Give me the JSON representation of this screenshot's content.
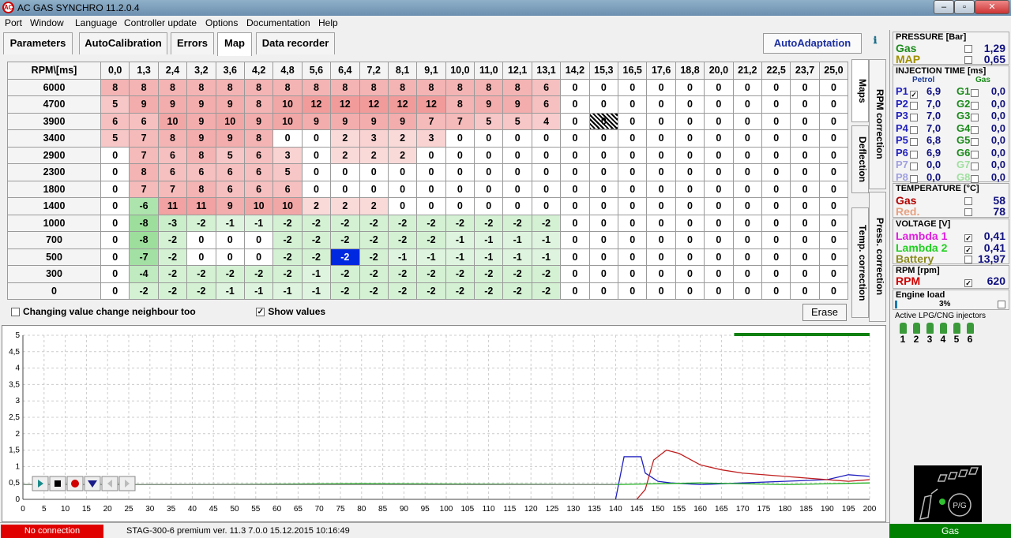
{
  "window": {
    "title": "AC GAS SYNCHRO  11.2.0.4",
    "min": "–",
    "max": "▫",
    "close": "✕"
  },
  "menu": [
    "Port",
    "Window",
    "Language",
    "Controller update",
    "Options",
    "Documentation",
    "Help"
  ],
  "tabs": [
    "Parameters",
    "AutoCalibration",
    "Errors",
    "Map",
    "Data recorder"
  ],
  "autoadaptation_label": "AutoAdaptation",
  "grid": {
    "corner": "RPM\\[ms]",
    "columns": [
      "0,0",
      "1,3",
      "2,4",
      "3,2",
      "3,6",
      "4,2",
      "4,8",
      "5,6",
      "6,4",
      "7,2",
      "8,1",
      "9,1",
      "10,0",
      "11,0",
      "12,1",
      "13,1",
      "14,2",
      "15,3",
      "16,5",
      "17,6",
      "18,8",
      "20,0",
      "21,2",
      "22,5",
      "23,7",
      "25,0"
    ],
    "rows": [
      {
        "rpm": "6000",
        "v": [
          8,
          8,
          8,
          8,
          8,
          8,
          8,
          8,
          8,
          8,
          8,
          8,
          8,
          8,
          8,
          6,
          0,
          0,
          0,
          0,
          0,
          0,
          0,
          0,
          0,
          0
        ]
      },
      {
        "rpm": "4700",
        "v": [
          5,
          9,
          9,
          9,
          9,
          8,
          10,
          12,
          12,
          12,
          12,
          12,
          8,
          9,
          9,
          6,
          0,
          0,
          0,
          0,
          0,
          0,
          0,
          0,
          0,
          0
        ]
      },
      {
        "rpm": "3900",
        "v": [
          6,
          6,
          10,
          9,
          10,
          9,
          10,
          9,
          9,
          9,
          9,
          7,
          7,
          5,
          5,
          4,
          0,
          0,
          0,
          0,
          0,
          0,
          0,
          0,
          0,
          0
        ]
      },
      {
        "rpm": "3400",
        "v": [
          5,
          7,
          8,
          9,
          9,
          8,
          0,
          0,
          2,
          3,
          2,
          3,
          0,
          0,
          0,
          0,
          0,
          0,
          0,
          0,
          0,
          0,
          0,
          0,
          0,
          0
        ]
      },
      {
        "rpm": "2900",
        "v": [
          0,
          7,
          6,
          8,
          5,
          6,
          3,
          0,
          2,
          2,
          2,
          0,
          0,
          0,
          0,
          0,
          0,
          0,
          0,
          0,
          0,
          0,
          0,
          0,
          0,
          0
        ]
      },
      {
        "rpm": "2300",
        "v": [
          0,
          8,
          6,
          6,
          6,
          6,
          5,
          0,
          0,
          0,
          0,
          0,
          0,
          0,
          0,
          0,
          0,
          0,
          0,
          0,
          0,
          0,
          0,
          0,
          0,
          0
        ]
      },
      {
        "rpm": "1800",
        "v": [
          0,
          7,
          7,
          8,
          6,
          6,
          6,
          0,
          0,
          0,
          0,
          0,
          0,
          0,
          0,
          0,
          0,
          0,
          0,
          0,
          0,
          0,
          0,
          0,
          0,
          0
        ]
      },
      {
        "rpm": "1400",
        "v": [
          0,
          -6,
          11,
          11,
          9,
          10,
          10,
          2,
          2,
          2,
          0,
          0,
          0,
          0,
          0,
          0,
          0,
          0,
          0,
          0,
          0,
          0,
          0,
          0,
          0,
          0
        ]
      },
      {
        "rpm": "1000",
        "v": [
          0,
          -8,
          -3,
          -2,
          -1,
          -1,
          -2,
          -2,
          -2,
          -2,
          -2,
          -2,
          -2,
          -2,
          -2,
          -2,
          0,
          0,
          0,
          0,
          0,
          0,
          0,
          0,
          0,
          0
        ]
      },
      {
        "rpm": "700",
        "v": [
          0,
          -8,
          -2,
          0,
          0,
          0,
          -2,
          -2,
          -2,
          -2,
          -2,
          -2,
          -1,
          -1,
          -1,
          -1,
          0,
          0,
          0,
          0,
          0,
          0,
          0,
          0,
          0,
          0
        ]
      },
      {
        "rpm": "500",
        "v": [
          0,
          -7,
          -2,
          0,
          0,
          0,
          -2,
          -2,
          -2,
          -2,
          -1,
          -1,
          -1,
          -1,
          -1,
          -1,
          0,
          0,
          0,
          0,
          0,
          0,
          0,
          0,
          0,
          0
        ]
      },
      {
        "rpm": "300",
        "v": [
          0,
          -4,
          -2,
          -2,
          -2,
          -2,
          -2,
          -1,
          -2,
          -2,
          -2,
          -2,
          -2,
          -2,
          -2,
          -2,
          0,
          0,
          0,
          0,
          0,
          0,
          0,
          0,
          0,
          0
        ]
      },
      {
        "rpm": "0",
        "v": [
          0,
          -2,
          -2,
          -2,
          -1,
          -1,
          -1,
          -1,
          -2,
          -2,
          -2,
          -2,
          -2,
          -2,
          -2,
          -2,
          0,
          0,
          0,
          0,
          0,
          0,
          0,
          0,
          0,
          0
        ]
      }
    ],
    "selected_cell": {
      "row": 10,
      "col": 8
    },
    "hatched_cell": {
      "row": 2,
      "col": 17
    }
  },
  "side_tabs": [
    "Maps",
    "RPM correction",
    "Deflection",
    "Temp. correction",
    "Press. correction"
  ],
  "options": {
    "neighbour_label": "Changing value change neighbour too",
    "show_values_label": "Show values",
    "erase_label": "Erase"
  },
  "chart_data": {
    "type": "line",
    "xlim": [
      0,
      200
    ],
    "ylim": [
      0,
      5
    ],
    "xticks": [
      0,
      5,
      10,
      15,
      20,
      25,
      30,
      35,
      40,
      45,
      50,
      55,
      60,
      65,
      70,
      75,
      80,
      85,
      90,
      95,
      100,
      105,
      110,
      115,
      120,
      125,
      130,
      135,
      140,
      145,
      150,
      155,
      160,
      165,
      170,
      175,
      180,
      185,
      190,
      195,
      200
    ],
    "yticks": [
      "0",
      "0,5",
      "1",
      "1,5",
      "2",
      "2,5",
      "3",
      "3,5",
      "4",
      "4,5",
      "5"
    ],
    "grid": true,
    "series": [
      {
        "color": "#2020c0",
        "x": [
          140,
          142,
          143,
          146,
          147,
          150,
          153,
          160,
          170,
          180,
          190,
          195,
          200
        ],
        "y": [
          0,
          1.3,
          1.3,
          1.3,
          0.8,
          0.55,
          0.5,
          0.45,
          0.5,
          0.55,
          0.6,
          0.75,
          0.7
        ]
      },
      {
        "color": "#c02020",
        "x": [
          145,
          147,
          149,
          152,
          155,
          160,
          165,
          170,
          180,
          190,
          195,
          200
        ],
        "y": [
          0,
          0.3,
          1.2,
          1.5,
          1.4,
          1.05,
          0.9,
          0.8,
          0.7,
          0.6,
          0.55,
          0.6
        ]
      },
      {
        "color": "#20b020",
        "x": [
          0,
          40,
          80,
          120,
          140,
          160,
          180,
          200
        ],
        "y": [
          0.45,
          0.45,
          0.48,
          0.46,
          0.45,
          0.5,
          0.45,
          0.5
        ]
      },
      {
        "color": "#888888",
        "x": [
          0,
          140
        ],
        "y": [
          0.45,
          0.45
        ]
      }
    ]
  },
  "status": {
    "connection": "No connection",
    "version": "STAG-300-6 premium   ver. 11.3  7.0.0    15.12.2015 10:16:49",
    "fuel": "Gas"
  },
  "right": {
    "pressure": {
      "title": "PRESSURE [Bar]",
      "gas_label": "Gas",
      "gas": "1,29",
      "map_label": "MAP",
      "map": "0,65"
    },
    "injection": {
      "title": "INJECTION TIME [ms]",
      "petrol": "Petrol",
      "gas": "Gas",
      "rows": [
        {
          "p": "P1",
          "pv": "6,9",
          "g": "G1",
          "gv": "0,0"
        },
        {
          "p": "P2",
          "pv": "7,0",
          "g": "G2",
          "gv": "0,0"
        },
        {
          "p": "P3",
          "pv": "7,0",
          "g": "G3",
          "gv": "0,0"
        },
        {
          "p": "P4",
          "pv": "7,0",
          "g": "G4",
          "gv": "0,0"
        },
        {
          "p": "P5",
          "pv": "6,8",
          "g": "G5",
          "gv": "0,0"
        },
        {
          "p": "P6",
          "pv": "6,9",
          "g": "G6",
          "gv": "0,0"
        },
        {
          "p": "P7",
          "pv": "0,0",
          "g": "G7",
          "gv": "0,0"
        },
        {
          "p": "P8",
          "pv": "0,0",
          "g": "G8",
          "gv": "0,0"
        }
      ]
    },
    "temperature": {
      "title": "TEMPERATURE [°C]",
      "gas_label": "Gas",
      "gas": "58",
      "red_label": "Red.",
      "red": "78"
    },
    "voltage": {
      "title": "VOLTAGE [V]",
      "l1_label": "Lambda 1",
      "l1": "0,41",
      "l2_label": "Lambda 2",
      "l2": "0,41",
      "bat_label": "Battery",
      "bat": "13,97"
    },
    "rpm": {
      "title": "RPM [rpm]",
      "label": "RPM",
      "value": "620"
    },
    "load": {
      "title": "Engine load",
      "value": "3%"
    },
    "injectors": {
      "title": "Active LPG/CNG injectors",
      "nums": [
        "1",
        "2",
        "3",
        "4",
        "5",
        "6"
      ]
    },
    "pg_label": "P/G"
  }
}
